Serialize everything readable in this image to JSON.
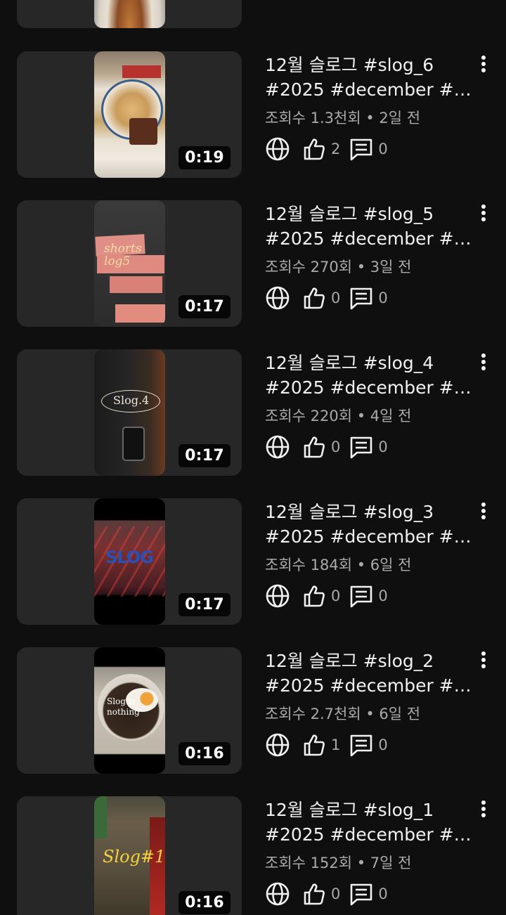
{
  "videos": [
    {
      "title_line1": "12월 슬로그 #slog_6",
      "title_line2": "#2025 #december  #f…",
      "views": "조회수 1.3천회",
      "age": "2일 전",
      "duration": "0:19",
      "likes": "2",
      "comments": "0",
      "thumb_overlay": ""
    },
    {
      "title_line1": "12월 슬로그 #slog_5",
      "title_line2": "#2025 #december  #…",
      "views": "조회수 270회",
      "age": "3일 전",
      "duration": "0:17",
      "likes": "0",
      "comments": "0",
      "thumb_overlay": "shorts log5"
    },
    {
      "title_line1": "12월 슬로그 #slog_4",
      "title_line2": "#2025 #december  #k…",
      "views": "조회수 220회",
      "age": "4일 전",
      "duration": "0:17",
      "likes": "0",
      "comments": "0",
      "thumb_overlay": "Slog.4"
    },
    {
      "title_line1": "12월 슬로그 #slog_3",
      "title_line2": "#2025 #december #s…",
      "views": "조회수 184회",
      "age": "6일 전",
      "duration": "0:17",
      "likes": "0",
      "comments": "0",
      "thumb_overlay": "SLOG"
    },
    {
      "title_line1": "12월 슬로그 #slog_2",
      "title_line2": "#2025 #december  #k…",
      "views": "조회수 2.7천회",
      "age": "6일 전",
      "duration": "0:16",
      "likes": "1",
      "comments": "0",
      "thumb_overlay": "Slog is nothing"
    },
    {
      "title_line1": "12월 슬로그 #slog_1",
      "title_line2": "#2025 #december  #…",
      "views": "조회수 152회",
      "age": "7일 전",
      "duration": "0:16",
      "likes": "0",
      "comments": "0",
      "thumb_overlay": "Slog#1"
    }
  ],
  "separator": " • ",
  "icons": {
    "visibility": "globe-icon",
    "like": "thumbs-up-icon",
    "comment": "comment-icon",
    "menu": "more-vert-icon"
  },
  "colors": {
    "background": "#0f0f0f",
    "card": "#272727",
    "text": "#f1f1f1",
    "secondary": "#aaaaaa"
  }
}
